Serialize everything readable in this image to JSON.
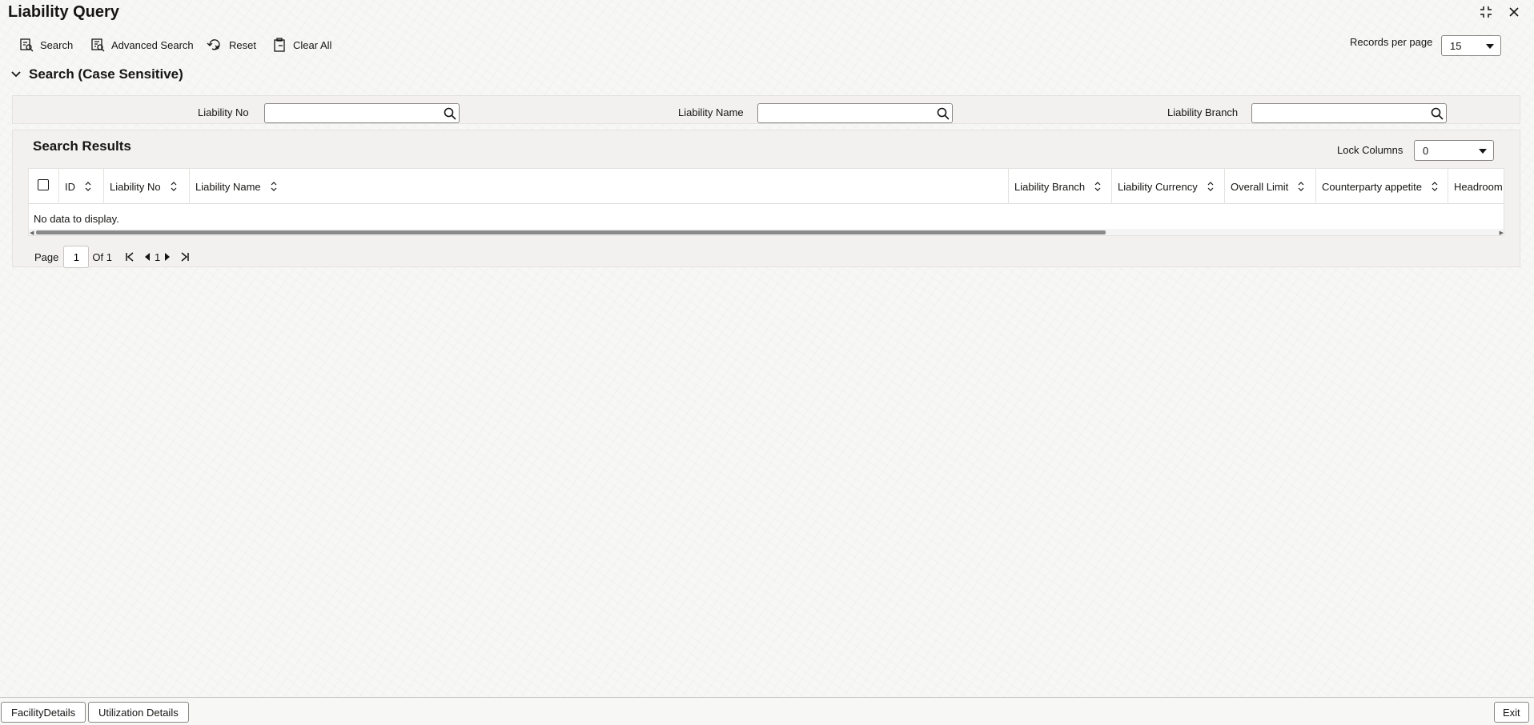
{
  "window": {
    "title": "Liability Query",
    "icons": {
      "maximize": "minimize-arrows-icon",
      "close": "close-icon"
    }
  },
  "toolbar": {
    "search_label": "Search",
    "advanced_search_label": "Advanced Search",
    "reset_label": "Reset",
    "clear_all_label": "Clear All",
    "records_per_page_label": "Records per page",
    "records_per_page_value": "15"
  },
  "search_section": {
    "title": "Search (Case Sensitive)",
    "fields": [
      {
        "label": "Liability No",
        "value": ""
      },
      {
        "label": "Liability Name",
        "value": ""
      },
      {
        "label": "Liability Branch",
        "value": ""
      }
    ]
  },
  "results": {
    "title": "Search Results",
    "lock_columns_label": "Lock Columns",
    "lock_columns_value": "0",
    "columns": [
      "ID",
      "Liability No",
      "Liability Name",
      "Liability Branch",
      "Liability Currency",
      "Overall Limit",
      "Counterparty appetite",
      "Headroom Li"
    ],
    "empty_message": "No data to display."
  },
  "pager": {
    "page_label": "Page",
    "current_page": "1",
    "of_label": "Of 1",
    "page_number": "1"
  },
  "footer": {
    "facility_details": "FacilityDetails",
    "utilization_details": "Utilization Details",
    "exit": "Exit"
  }
}
